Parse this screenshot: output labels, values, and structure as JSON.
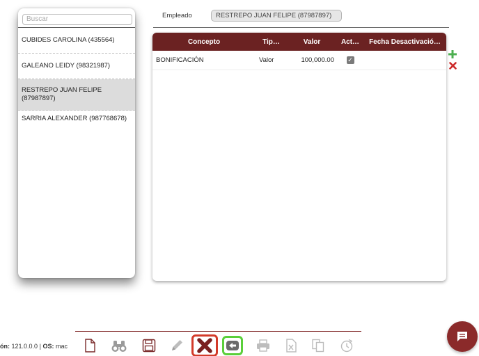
{
  "search": {
    "placeholder": "Buscar",
    "value": ""
  },
  "employees": [
    {
      "name": "CUBIDES CAROLINA (435564)"
    },
    {
      "name": "GALEANO LEIDY (98321987)"
    },
    {
      "name": "RESTREPO JUAN FELIPE (87987897)",
      "selected": true
    },
    {
      "name": "SARRIA ALEXANDER (987768678)"
    }
  ],
  "empleado": {
    "label": "Empleado",
    "value": "RESTREPO  JUAN FELIPE (87987897)"
  },
  "grid": {
    "columns": [
      "Concepto",
      "Tip…",
      "Valor",
      "Act…",
      "Fecha Desactivació…"
    ],
    "rows": [
      {
        "concepto": "BONIFICACIÓN",
        "tipo": "Valor",
        "valor": "100,000.00",
        "activo": true,
        "fecha": ""
      }
    ]
  },
  "footer": {
    "version_label": "ón:",
    "version_value": "121.0.0.0",
    "separator": "|",
    "os_label": "OS:",
    "os_value": "mac"
  },
  "colors": {
    "accent": "#6b2222",
    "add": "#4caf50",
    "delete": "#cc2a2a"
  },
  "toolbar_icons": [
    "new-document-icon",
    "binoculars-icon",
    "save-icon",
    "edit-icon",
    "cancel-icon",
    "back-icon",
    "print-icon",
    "excel-icon",
    "copy-icon",
    "history-icon"
  ]
}
